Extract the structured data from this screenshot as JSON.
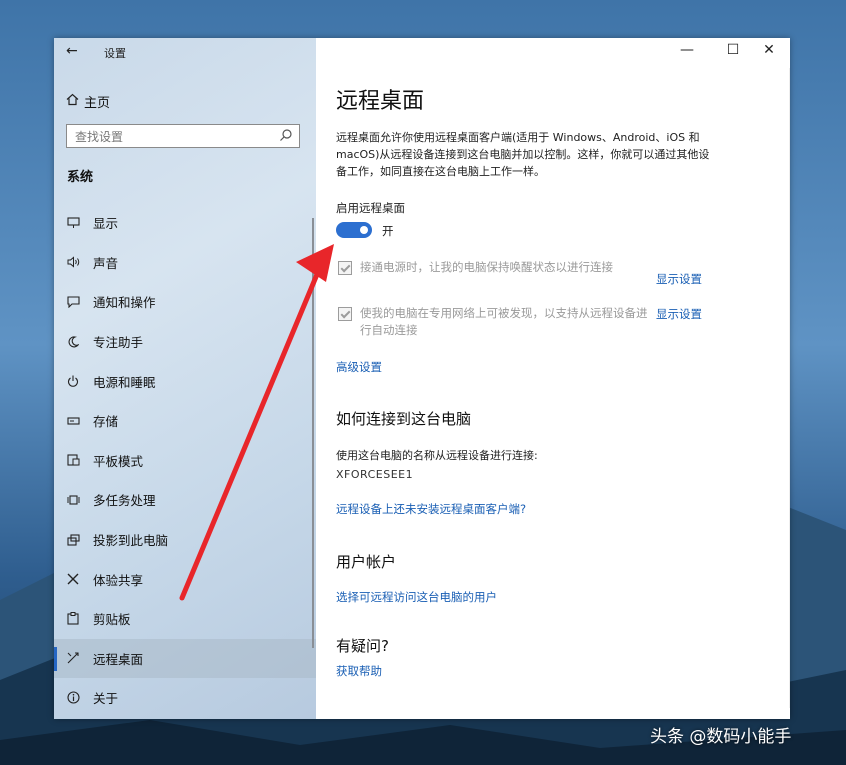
{
  "window": {
    "title": "设置",
    "back_icon": "back-arrow-icon",
    "controls": [
      "minimize-icon",
      "maximize-icon",
      "close-icon"
    ]
  },
  "sidebar": {
    "home_label": "主页",
    "search_placeholder": "查找设置",
    "section_title": "系统",
    "items": [
      {
        "label": "显示",
        "icon": "monitor-icon"
      },
      {
        "label": "声音",
        "icon": "speaker-icon"
      },
      {
        "label": "通知和操作",
        "icon": "notification-icon"
      },
      {
        "label": "专注助手",
        "icon": "moon-icon"
      },
      {
        "label": "电源和睡眠",
        "icon": "power-icon"
      },
      {
        "label": "存储",
        "icon": "storage-icon"
      },
      {
        "label": "平板模式",
        "icon": "tablet-icon"
      },
      {
        "label": "多任务处理",
        "icon": "multitask-icon"
      },
      {
        "label": "投影到此电脑",
        "icon": "project-icon"
      },
      {
        "label": "体验共享",
        "icon": "share-icon"
      },
      {
        "label": "剪贴板",
        "icon": "clipboard-icon"
      },
      {
        "label": "远程桌面",
        "icon": "remote-desktop-icon",
        "active": true
      },
      {
        "label": "关于",
        "icon": "info-icon"
      }
    ]
  },
  "content": {
    "title": "远程桌面",
    "description": "远程桌面允许你使用远程桌面客户端(适用于 Windows、Android、iOS 和 macOS)从远程设备连接到这台电脑并加以控制。这样，你就可以通过其他设备工作，如同直接在这台电脑上工作一样。",
    "enable_label": "启用远程桌面",
    "toggle_state": "开",
    "option1_text": "接通电源时，让我的电脑保持唤醒状态以进行连接",
    "option2_text": "使我的电脑在专用网络上可被发现，以支持从远程设备进行自动连接",
    "show_settings": "显示设置",
    "advanced_settings": "高级设置",
    "how_to_connect_heading": "如何连接到这台电脑",
    "connect_text": "使用这台电脑的名称从远程设备进行连接:",
    "pc_name": "XFORCESEE1",
    "no_client_link": "远程设备上还未安装远程桌面客户端?",
    "user_accounts_heading": "用户帐户",
    "select_users_link": "选择可远程访问这台电脑的用户",
    "questions_heading": "有疑问?",
    "get_help_link": "获取帮助"
  },
  "watermark": "头条 @数码小能手",
  "colors": {
    "accent": "#2c6fd0",
    "link": "#1a5fb4",
    "arrow": "#e8262a"
  }
}
